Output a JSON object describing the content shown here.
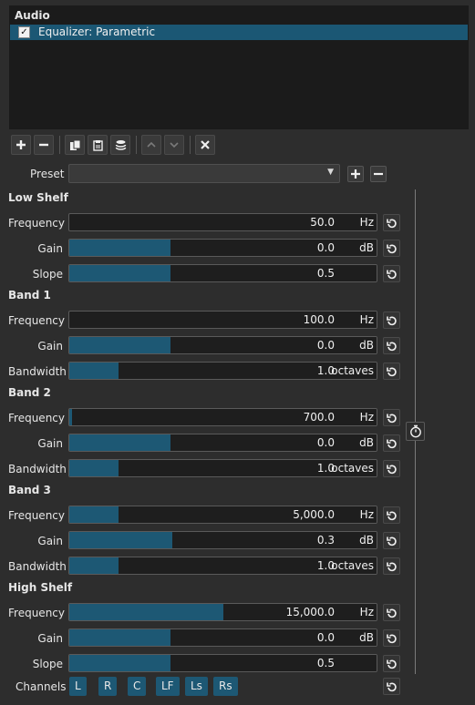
{
  "panel": {
    "title": "Audio",
    "filters": [
      {
        "name": "Equalizer: Parametric",
        "checked": true
      }
    ]
  },
  "toolbar": {
    "buttons": [
      {
        "name": "add-filter-button",
        "icon": "plus-icon"
      },
      {
        "name": "remove-filter-button",
        "icon": "minus-icon"
      },
      {
        "name": "copy-filter-button",
        "icon": "copy-icon"
      },
      {
        "name": "paste-filter-button",
        "icon": "paste-icon"
      },
      {
        "name": "save-filter-set-button",
        "icon": "stack-icon"
      },
      {
        "name": "move-up-button",
        "icon": "chevron-up-icon"
      },
      {
        "name": "move-down-button",
        "icon": "chevron-down-icon"
      },
      {
        "name": "deselect-filter-button",
        "icon": "close-icon"
      }
    ]
  },
  "preset": {
    "label": "Preset",
    "value": ""
  },
  "groups": [
    {
      "title": "Low Shelf",
      "params": [
        {
          "label": "Frequency",
          "value": "50.0",
          "unit": "Hz",
          "fill": 0.0
        },
        {
          "label": "Gain",
          "value": "0.0",
          "unit": "dB",
          "fill": 0.33
        },
        {
          "label": "Slope",
          "value": "0.5",
          "unit": "",
          "fill": 0.33
        }
      ]
    },
    {
      "title": "Band 1",
      "params": [
        {
          "label": "Frequency",
          "value": "100.0",
          "unit": "Hz",
          "fill": 0.0
        },
        {
          "label": "Gain",
          "value": "0.0",
          "unit": "dB",
          "fill": 0.33
        },
        {
          "label": "Bandwidth",
          "value": "1.0",
          "unit": "octaves",
          "fill": 0.16
        }
      ]
    },
    {
      "title": "Band 2",
      "params": [
        {
          "label": "Frequency",
          "value": "700.0",
          "unit": "Hz",
          "fill": 0.01
        },
        {
          "label": "Gain",
          "value": "0.0",
          "unit": "dB",
          "fill": 0.33
        },
        {
          "label": "Bandwidth",
          "value": "1.0",
          "unit": "octaves",
          "fill": 0.16
        }
      ]
    },
    {
      "title": "Band 3",
      "params": [
        {
          "label": "Frequency",
          "value": "5,000.0",
          "unit": "Hz",
          "fill": 0.16
        },
        {
          "label": "Gain",
          "value": "0.3",
          "unit": "dB",
          "fill": 0.335
        },
        {
          "label": "Bandwidth",
          "value": "1.0",
          "unit": "octaves",
          "fill": 0.16
        }
      ]
    },
    {
      "title": "High Shelf",
      "params": [
        {
          "label": "Frequency",
          "value": "15,000.0",
          "unit": "Hz",
          "fill": 0.5
        },
        {
          "label": "Gain",
          "value": "0.0",
          "unit": "dB",
          "fill": 0.33
        },
        {
          "label": "Slope",
          "value": "0.5",
          "unit": "",
          "fill": 0.33
        }
      ]
    }
  ],
  "channels": {
    "label": "Channels",
    "buttons": [
      "L",
      "R",
      "C",
      "LF",
      "Ls",
      "Rs"
    ]
  },
  "colors": {
    "accent": "#1d5874",
    "background": "#2d2d2d",
    "field": "#1e1e1e"
  }
}
